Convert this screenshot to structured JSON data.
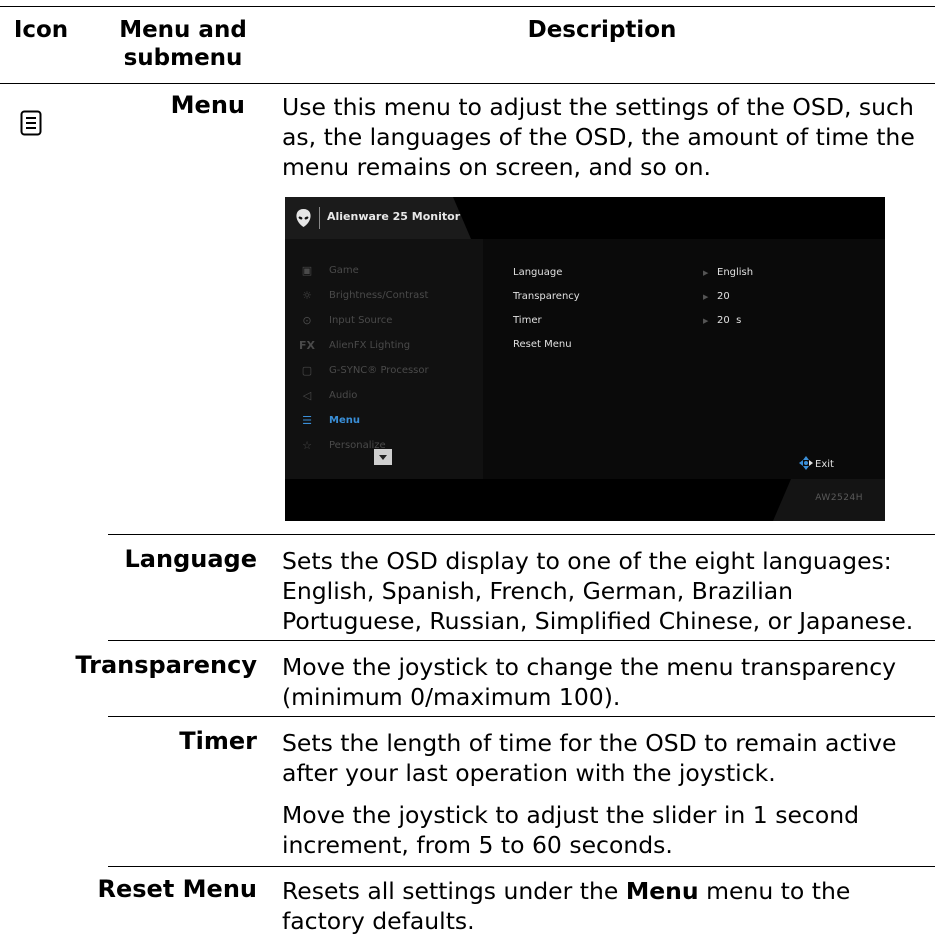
{
  "header": {
    "col_icon": "Icon",
    "col_menu": "Menu and submenu",
    "col_desc": "Description"
  },
  "menu_row": {
    "title": "Menu",
    "icon": "menu-list-icon",
    "description": "Use this menu to adjust the settings of the OSD, such as, the languages of the OSD, the amount of time the menu remains on screen, and so on."
  },
  "osd": {
    "brand": "Alienware 25 Monitor",
    "model": "AW2524H",
    "menu_items": [
      {
        "label": "Game",
        "icon": "gamepad-icon"
      },
      {
        "label": "Brightness/Contrast",
        "icon": "sun-icon"
      },
      {
        "label": "Input Source",
        "icon": "input-icon"
      },
      {
        "label": "AlienFX Lighting",
        "icon": "fx-icon"
      },
      {
        "label": "G-SYNC® Processor",
        "icon": "chip-icon"
      },
      {
        "label": "Audio",
        "icon": "speaker-icon"
      },
      {
        "label": "Menu",
        "icon": "menu-list-icon"
      },
      {
        "label": "Personalize",
        "icon": "star-icon"
      }
    ],
    "active_item": "Menu",
    "options": [
      {
        "label": "Language",
        "value": "English"
      },
      {
        "label": "Transparency",
        "value": "20"
      },
      {
        "label": "Timer",
        "value": "20  s"
      },
      {
        "label": "Reset Menu",
        "value": ""
      }
    ],
    "exit_label": "Exit",
    "accent_color": "#3a8fd8"
  },
  "rows": [
    {
      "name": "Language",
      "desc": [
        "Sets the OSD display to one of the eight languages: English, Spanish, French, German, Brazilian Portuguese, Russian, Simplified Chinese, or Japanese."
      ]
    },
    {
      "name": "Transparency",
      "desc": [
        "Move the joystick to change the menu transparency (minimum 0/maximum 100)."
      ]
    },
    {
      "name": "Timer",
      "desc": [
        "Sets the length of time for the OSD to remain active after your last operation with the joystick.",
        "Move the joystick to adjust the slider in 1 second increment, from 5 to 60 seconds."
      ]
    },
    {
      "name": "Reset Menu",
      "desc_prefix": "Resets all settings under the ",
      "desc_bold": "Menu",
      "desc_suffix": " menu to the factory defaults."
    }
  ]
}
